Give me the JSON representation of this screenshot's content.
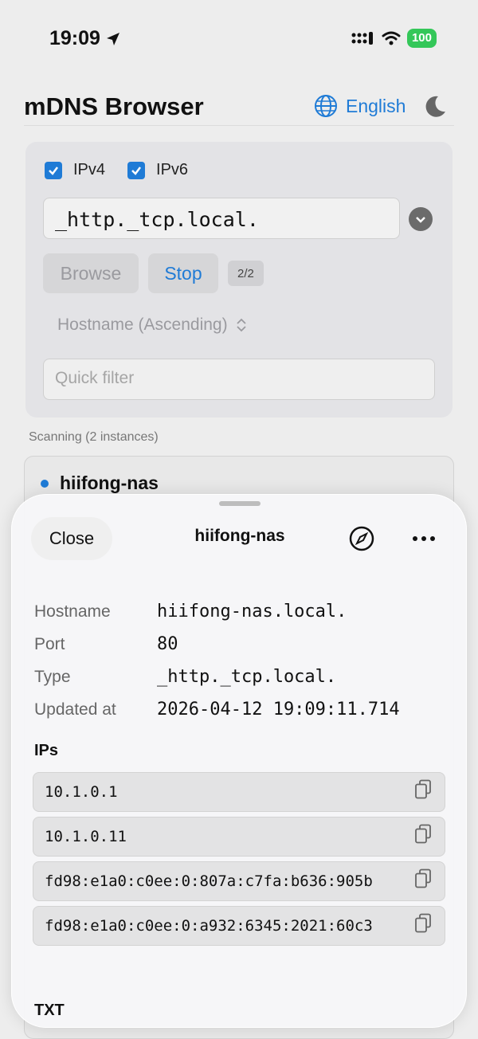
{
  "status": {
    "time": "19:09",
    "battery": "100"
  },
  "header": {
    "title": "mDNS Browser",
    "language": "English"
  },
  "controls": {
    "ipv4_label": "IPv4",
    "ipv6_label": "IPv6",
    "service_type": "_http._tcp.local.",
    "browse_label": "Browse",
    "stop_label": "Stop",
    "progress": "2/2",
    "sort_label": "Hostname (Ascending)",
    "filter_placeholder": "Quick filter"
  },
  "scanning_text": "Scanning (2 instances)",
  "instance": {
    "name": "hiifong-nas"
  },
  "sheet": {
    "close_label": "Close",
    "title": "hiifong-nas",
    "rows": [
      {
        "label": "Hostname",
        "value": "hiifong-nas.local."
      },
      {
        "label": "Port",
        "value": "80"
      },
      {
        "label": "Type",
        "value": "_http._tcp.local."
      },
      {
        "label": "Updated at",
        "value": "2026-04-12 19:09:11.714"
      }
    ],
    "ips_heading": "IPs",
    "ips": [
      "10.1.0.1",
      "10.1.0.11",
      "fd98:e1a0:c0ee:0:807a:c7fa:b636:905b",
      "fd98:e1a0:c0ee:0:a932:6345:2021:60c3"
    ],
    "txt_heading": "TXT"
  },
  "colors": {
    "accent": "#1f7bd6",
    "battery": "#34c759"
  },
  "icons": [
    "location-arrow-icon",
    "cellular-icon",
    "wifi-icon",
    "globe-icon",
    "moon-icon",
    "checkbox-icon",
    "chevron-down-icon",
    "sort-chevron-icon",
    "compass-icon",
    "more-icon",
    "copy-icon"
  ]
}
